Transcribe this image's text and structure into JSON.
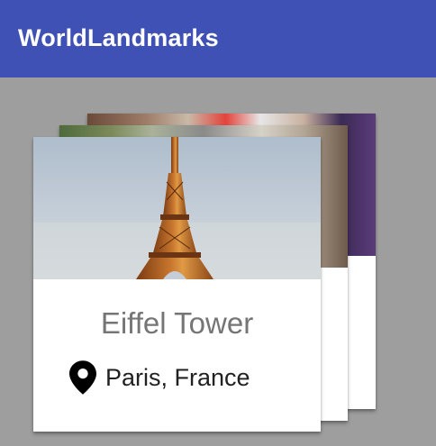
{
  "app_bar": {
    "title": "WorldLandmarks",
    "color": "#3f51b5"
  },
  "background_color": "#9e9e9e",
  "cards": [
    {
      "name": "Eiffel Tower",
      "location": "Paris, France",
      "icon": "location-pin-icon"
    }
  ]
}
